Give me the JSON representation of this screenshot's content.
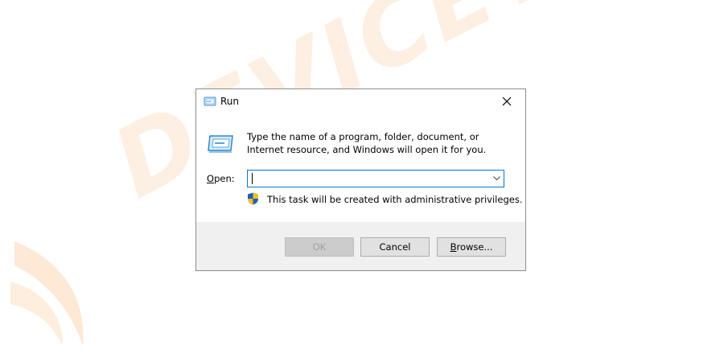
{
  "window": {
    "title": "Run",
    "title_icon": "run-icon",
    "close_icon": "close-icon"
  },
  "content": {
    "icon": "run-large-icon",
    "description": "Type the name of a program, folder, document, or Internet resource, and Windows will open it for you.",
    "open_label_mnemonic": "O",
    "open_label_rest": "pen:",
    "input_value": "",
    "dropdown_icon": "chevron-down-icon",
    "admin_icon": "uac-shield-icon",
    "admin_note": "This task will be created with administrative privileges."
  },
  "buttons": {
    "ok_label": "OK",
    "cancel_label": "Cancel",
    "browse_mnemonic": "B",
    "browse_rest": "rowse..."
  },
  "watermark": {
    "text": "DEVICETRICKS"
  },
  "colors": {
    "accent": "#0078d7",
    "watermark": "#fdf0e2",
    "footer": "#f0f0f0"
  }
}
